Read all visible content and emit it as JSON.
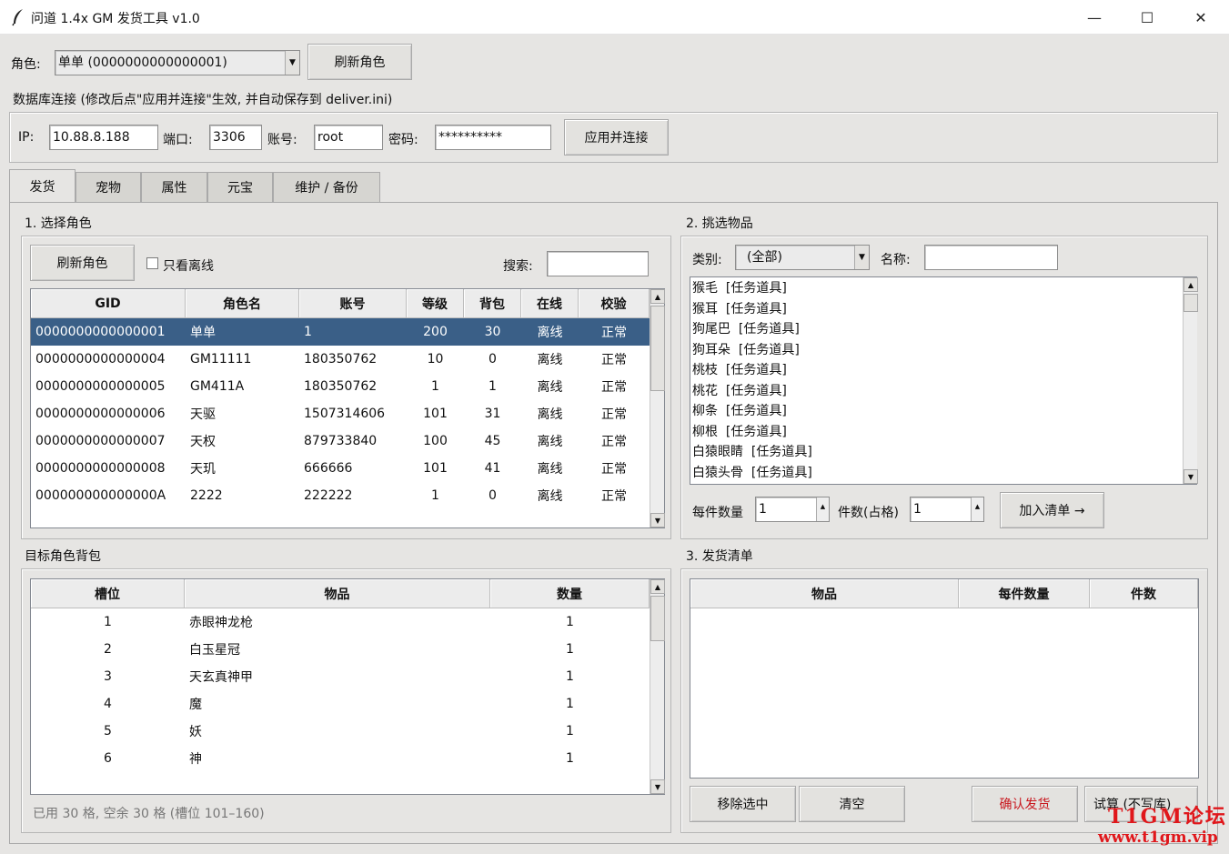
{
  "window": {
    "title": "问道 1.4x GM 发货工具  v1.0",
    "min_glyph": "—",
    "max_glyph": "☐",
    "close_glyph": "✕"
  },
  "role_bar": {
    "label": "角色:",
    "combo_value": "单单 (0000000000000001)",
    "refresh": "刷新角色"
  },
  "db": {
    "section_title": "数据库连接 (修改后点\"应用并连接\"生效, 并自动保存到 deliver.ini)",
    "ip_label": "IP:",
    "ip": "10.88.8.188",
    "port_label": "端口:",
    "port": "3306",
    "user_label": "账号:",
    "user": "root",
    "pwd_label": "密码:",
    "pwd": "**********",
    "apply": "应用并连接"
  },
  "tabs": [
    "发货",
    "宠物",
    "属性",
    "元宝",
    "维护 / 备份"
  ],
  "select_role": {
    "title": "1. 选择角色",
    "refresh": "刷新角色",
    "offline_only": "只看离线",
    "search_label": "搜索:",
    "columns": [
      "GID",
      "角色名",
      "账号",
      "等级",
      "背包",
      "在线",
      "校验"
    ],
    "rows": [
      [
        "0000000000000001",
        "单单",
        "1",
        "200",
        "30",
        "离线",
        "正常"
      ],
      [
        "0000000000000004",
        "GM11111",
        "180350762",
        "10",
        "0",
        "离线",
        "正常"
      ],
      [
        "0000000000000005",
        "GM411A",
        "180350762",
        "1",
        "1",
        "离线",
        "正常"
      ],
      [
        "0000000000000006",
        "天驱",
        "1507314606",
        "101",
        "31",
        "离线",
        "正常"
      ],
      [
        "0000000000000007",
        "天权",
        "879733840",
        "100",
        "45",
        "离线",
        "正常"
      ],
      [
        "0000000000000008",
        "天玑",
        "666666",
        "101",
        "41",
        "离线",
        "正常"
      ],
      [
        "000000000000000A",
        "2222",
        "222222",
        "1",
        "0",
        "离线",
        "正常"
      ]
    ]
  },
  "pick_items": {
    "title": "2. 挑选物品",
    "category_label": "类别:",
    "category_value": "(全部)",
    "name_label": "名称:",
    "items": [
      "猴毛  [任务道具]",
      "猴耳  [任务道具]",
      "狗尾巴  [任务道具]",
      "狗耳朵  [任务道具]",
      "桃枝  [任务道具]",
      "桃花  [任务道具]",
      "柳条  [任务道具]",
      "柳根  [任务道具]",
      "白猿眼睛  [任务道具]",
      "白猿头骨  [任务道具]"
    ],
    "per_qty_label": "每件数量",
    "per_qty": "1",
    "count_label": "件数(占格)",
    "count": "1",
    "add_button": "加入清单 →"
  },
  "bag": {
    "title": "目标角色背包",
    "columns": [
      "槽位",
      "物品",
      "数量"
    ],
    "rows": [
      [
        "1",
        "赤眼神龙枪",
        "1"
      ],
      [
        "2",
        "白玉星冠",
        "1"
      ],
      [
        "3",
        "天玄真神甲",
        "1"
      ],
      [
        "4",
        "魔",
        "1"
      ],
      [
        "5",
        "妖",
        "1"
      ],
      [
        "6",
        "神",
        "1"
      ]
    ],
    "status": "已用 30 格, 空余 30 格 (槽位 101–160)"
  },
  "deliver_list": {
    "title": "3. 发货清单",
    "columns": [
      "物品",
      "每件数量",
      "件数"
    ],
    "remove": "移除选中",
    "clear": "清空",
    "confirm": "确认发货",
    "trial": "试算 (不写库)",
    "confirm_color": "#c8161d"
  },
  "watermark": {
    "line1": "T1GM论坛",
    "line2": "www.t1gm.vip"
  }
}
